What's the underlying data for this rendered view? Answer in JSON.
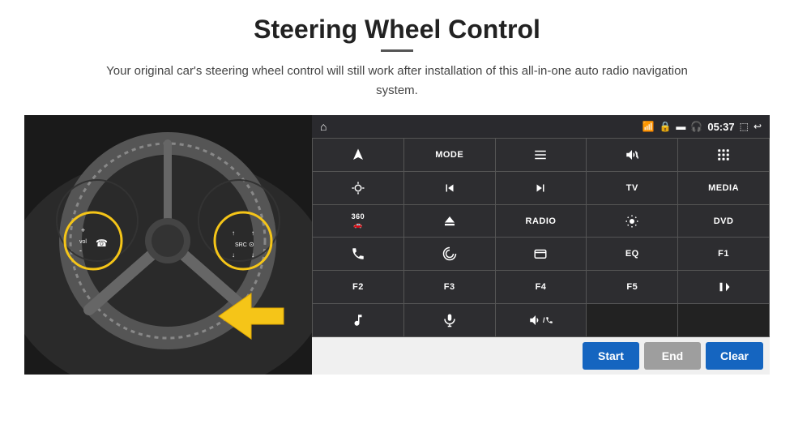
{
  "header": {
    "title": "Steering Wheel Control",
    "subtitle": "Your original car's steering wheel control will still work after installation of this all-in-one auto radio navigation system."
  },
  "status_bar": {
    "wifi_icon": "wifi",
    "time": "05:37"
  },
  "grid_buttons": [
    {
      "id": "r0c0",
      "type": "icon",
      "icon": "navigate",
      "label": ""
    },
    {
      "id": "r0c1",
      "type": "text",
      "label": "MODE"
    },
    {
      "id": "r0c2",
      "type": "icon",
      "icon": "list",
      "label": ""
    },
    {
      "id": "r0c3",
      "type": "icon",
      "icon": "mute",
      "label": ""
    },
    {
      "id": "r0c4",
      "type": "icon",
      "icon": "apps",
      "label": ""
    },
    {
      "id": "r1c0",
      "type": "icon",
      "icon": "settings-ring",
      "label": ""
    },
    {
      "id": "r1c1",
      "type": "icon",
      "icon": "rewind",
      "label": ""
    },
    {
      "id": "r1c2",
      "type": "icon",
      "icon": "forward",
      "label": ""
    },
    {
      "id": "r1c3",
      "type": "text",
      "label": "TV"
    },
    {
      "id": "r1c4",
      "type": "text",
      "label": "MEDIA"
    },
    {
      "id": "r2c0",
      "type": "text",
      "icon": "360cam",
      "label": "360"
    },
    {
      "id": "r2c1",
      "type": "icon",
      "icon": "eject",
      "label": ""
    },
    {
      "id": "r2c2",
      "type": "text",
      "label": "RADIO"
    },
    {
      "id": "r2c3",
      "type": "icon",
      "icon": "brightness",
      "label": ""
    },
    {
      "id": "r2c4",
      "type": "text",
      "label": "DVD"
    },
    {
      "id": "r3c0",
      "type": "icon",
      "icon": "phone",
      "label": ""
    },
    {
      "id": "r3c1",
      "type": "icon",
      "icon": "swirl",
      "label": ""
    },
    {
      "id": "r3c2",
      "type": "icon",
      "icon": "window",
      "label": ""
    },
    {
      "id": "r3c3",
      "type": "text",
      "label": "EQ"
    },
    {
      "id": "r3c4",
      "type": "text",
      "label": "F1"
    },
    {
      "id": "r4c0",
      "type": "text",
      "label": "F2"
    },
    {
      "id": "r4c1",
      "type": "text",
      "label": "F3"
    },
    {
      "id": "r4c2",
      "type": "text",
      "label": "F4"
    },
    {
      "id": "r4c3",
      "type": "text",
      "label": "F5"
    },
    {
      "id": "r4c4",
      "type": "icon",
      "icon": "play-pause",
      "label": ""
    },
    {
      "id": "r5c0",
      "type": "icon",
      "icon": "music",
      "label": ""
    },
    {
      "id": "r5c1",
      "type": "icon",
      "icon": "mic",
      "label": ""
    },
    {
      "id": "r5c2",
      "type": "icon",
      "icon": "volume-call",
      "label": ""
    },
    {
      "id": "r5c3",
      "type": "empty",
      "label": ""
    },
    {
      "id": "r5c4",
      "type": "empty",
      "label": ""
    }
  ],
  "action_buttons": {
    "start": "Start",
    "end": "End",
    "clear": "Clear"
  }
}
